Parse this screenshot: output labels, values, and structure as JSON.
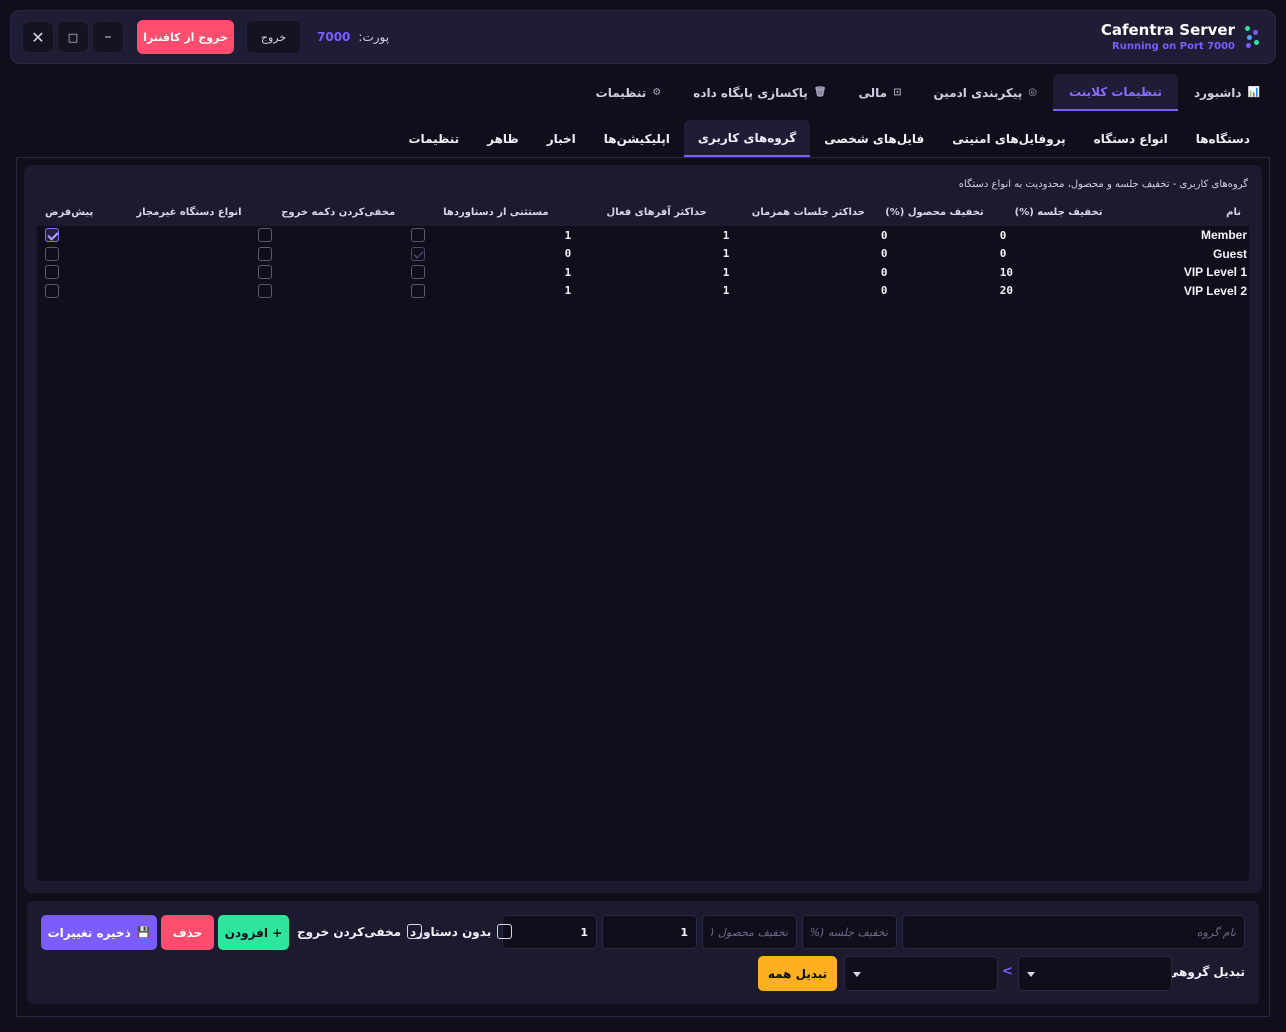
{
  "app": {
    "title": "Cafentra Server",
    "subtitle": "Running on Port 7000"
  },
  "topbar": {
    "port_label": "پورت:",
    "port_value": "7000",
    "exit_label": "خروج",
    "exit_cafentra_label": "خروج از کافنترا",
    "minimize": "–",
    "maximize": "□",
    "close": "✕"
  },
  "main_tabs": [
    {
      "label": "داشبورد",
      "icon": "chart-icon",
      "glyph": "📊"
    },
    {
      "label": "تنظیمات کلاینت",
      "icon": "",
      "glyph": ""
    },
    {
      "label": "پیکربندی ادمین",
      "icon": "gear-circle-icon",
      "glyph": "◎"
    },
    {
      "label": "مالی",
      "icon": "dollar-icon",
      "glyph": "⊡"
    },
    {
      "label": "پاکسازی پایگاه داده",
      "icon": "trash-icon",
      "glyph": "🗑"
    },
    {
      "label": "تنظیمات",
      "icon": "gear-icon",
      "glyph": "⚙"
    }
  ],
  "sub_tabs": [
    {
      "label": "دستگاه‌ها"
    },
    {
      "label": "انواع دستگاه"
    },
    {
      "label": "پروفایل‌های امنیتی"
    },
    {
      "label": "فایل‌های شخصی"
    },
    {
      "label": "گروه‌های کاربری"
    },
    {
      "label": "اپلیکیشن‌ها"
    },
    {
      "label": "اخبار"
    },
    {
      "label": "ظاهر"
    },
    {
      "label": "تنظیمات"
    }
  ],
  "panel": {
    "description": "گروه‌های کاربری - تخفیف جلسه و محصول، محدودیت به انواع دستگاه",
    "columns": [
      "نام",
      "تخفیف جلسه (%)",
      "تخفیف محصول (%)",
      "حداکثر جلسات همزمان",
      "حداکثر آفرهای فعال",
      "مستثنی از دستاوردها",
      "مخفی‌کردن دکمه خروج",
      "انواع دستگاه غیرمجاز",
      "پیش‌فرض"
    ],
    "rows": [
      {
        "name": "Member",
        "session_discount": "0",
        "product_discount": "0",
        "max_sessions": "1",
        "max_offers": "1",
        "exempt": false,
        "hide_exit": false,
        "denied_types": "",
        "default": true
      },
      {
        "name": "Guest",
        "session_discount": "0",
        "product_discount": "0",
        "max_sessions": "1",
        "max_offers": "0",
        "exempt": true,
        "hide_exit": false,
        "denied_types": "",
        "default": false
      },
      {
        "name": "VIP Level 1",
        "session_discount": "10",
        "product_discount": "0",
        "max_sessions": "1",
        "max_offers": "1",
        "exempt": false,
        "hide_exit": false,
        "denied_types": "",
        "default": false
      },
      {
        "name": "VIP Level 2",
        "session_discount": "20",
        "product_discount": "0",
        "max_sessions": "1",
        "max_offers": "1",
        "exempt": false,
        "hide_exit": false,
        "denied_types": "",
        "default": false
      }
    ]
  },
  "form": {
    "group_name_placeholder": "نام گروه",
    "session_discount_placeholder": "تخفیف جلسه (%)",
    "product_discount_placeholder": "تخفیف محصول (%)",
    "max_sessions_value": "1",
    "max_offers_value": "1",
    "no_achievements_label": "بدون دستاورد",
    "hide_exit_label": "مخفی‌کردن خروج",
    "add_label": "+ افزودن",
    "delete_label": "حذف",
    "save_label": "ذخیره تغییرات",
    "convert_label": "تبدیل گروهی:",
    "arrow": "<",
    "convert_all_label": "تبدیل همه"
  },
  "colors": {
    "accent": "#7c5cff",
    "danger": "#ff4d6d",
    "success": "#2ee59d",
    "warning": "#ffb020"
  }
}
